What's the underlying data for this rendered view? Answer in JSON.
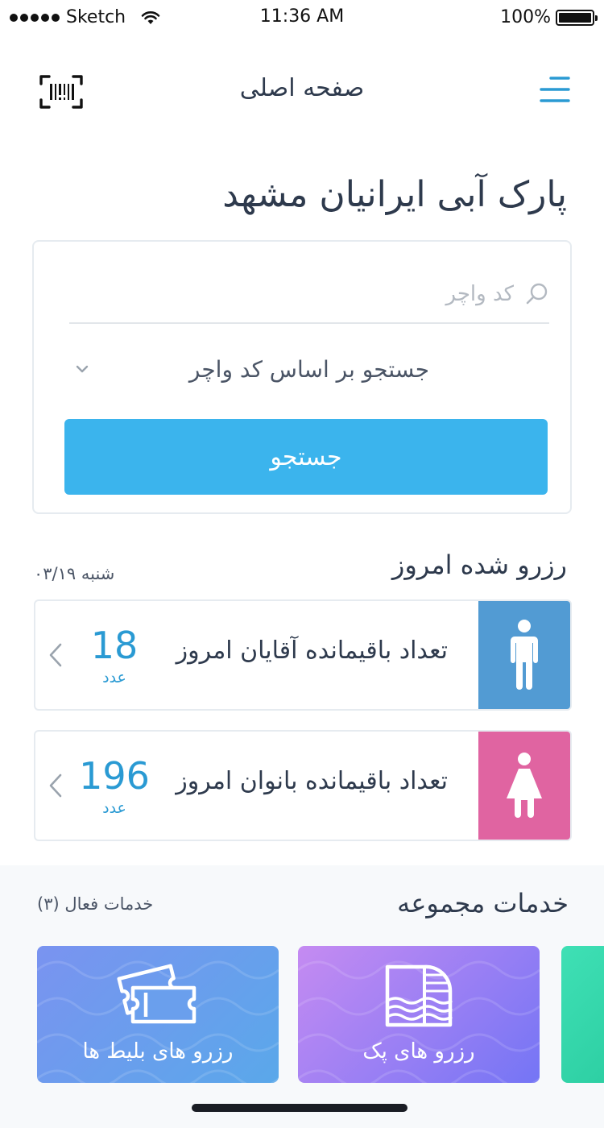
{
  "status_bar": {
    "carrier": "Sketch",
    "time": "11:36 AM",
    "battery": "100%",
    "battery_level": 1.0
  },
  "nav": {
    "title": "صفحه اصلی",
    "scan_icon": "barcode-scan-icon",
    "menu_icon": "hamburger-menu-icon"
  },
  "park_title": "پارک آبی ایرانیان مشهد",
  "search": {
    "placeholder": "کد واچر",
    "value": "",
    "select_value": "جستجو بر اساس کد واچر",
    "button_label": "جستجو"
  },
  "reservations": {
    "heading": "رزرو شده امروز",
    "date": "شنبه ۰۳/۱۹",
    "items": [
      {
        "label": "تعداد باقیمانده آقایان امروز",
        "count": "18",
        "unit": "عدد",
        "icon": "man-icon",
        "color": "#529bd3"
      },
      {
        "label": "تعداد باقیمانده بانوان امروز",
        "count": "196",
        "unit": "عدد",
        "icon": "woman-icon",
        "color": "#e064a1"
      }
    ]
  },
  "services": {
    "heading": "خدمات مجموعه",
    "active_count": "خدمات فعال (۳)",
    "items": [
      {
        "label": "رزرو های بلیط ها",
        "icon": "tickets-icon"
      },
      {
        "label": "رزرو های پک",
        "icon": "pool-icon"
      }
    ]
  },
  "colors": {
    "accent": "#3bb4ed",
    "number": "#2a9ad3",
    "text": "#2e3a4d"
  }
}
